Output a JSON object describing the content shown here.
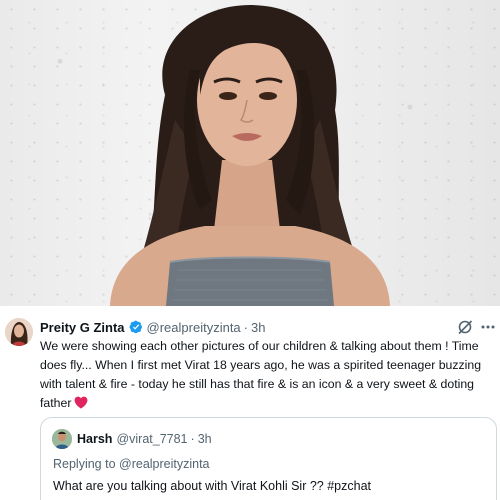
{
  "tweet": {
    "display_name": "Preity G Zinta",
    "handle": "@realpreityzinta",
    "separator": "·",
    "time": "3h",
    "text": "We were showing each other pictures of our children & talking about them ! Time does fly... When I first met Virat 18 years ago, he was a spirited teenager buzzing with talent & fire - today he still has that fire & is an icon & a very sweet & doting father",
    "verified_color": "#1d9bf0",
    "heart_color": "#e0245e"
  },
  "quoted": {
    "display_name": "Harsh",
    "handle": "@virat_7781",
    "separator": "·",
    "time": "3h",
    "replying_to": "Replying to @realpreityzinta",
    "text": "What are you talking about with Virat Kohli Sir ?? #pzchat"
  },
  "icons": {
    "verified": "verified-badge-icon",
    "grok": "grok-icon",
    "more": "more-options-icon",
    "heart": "red-heart-emoji"
  }
}
